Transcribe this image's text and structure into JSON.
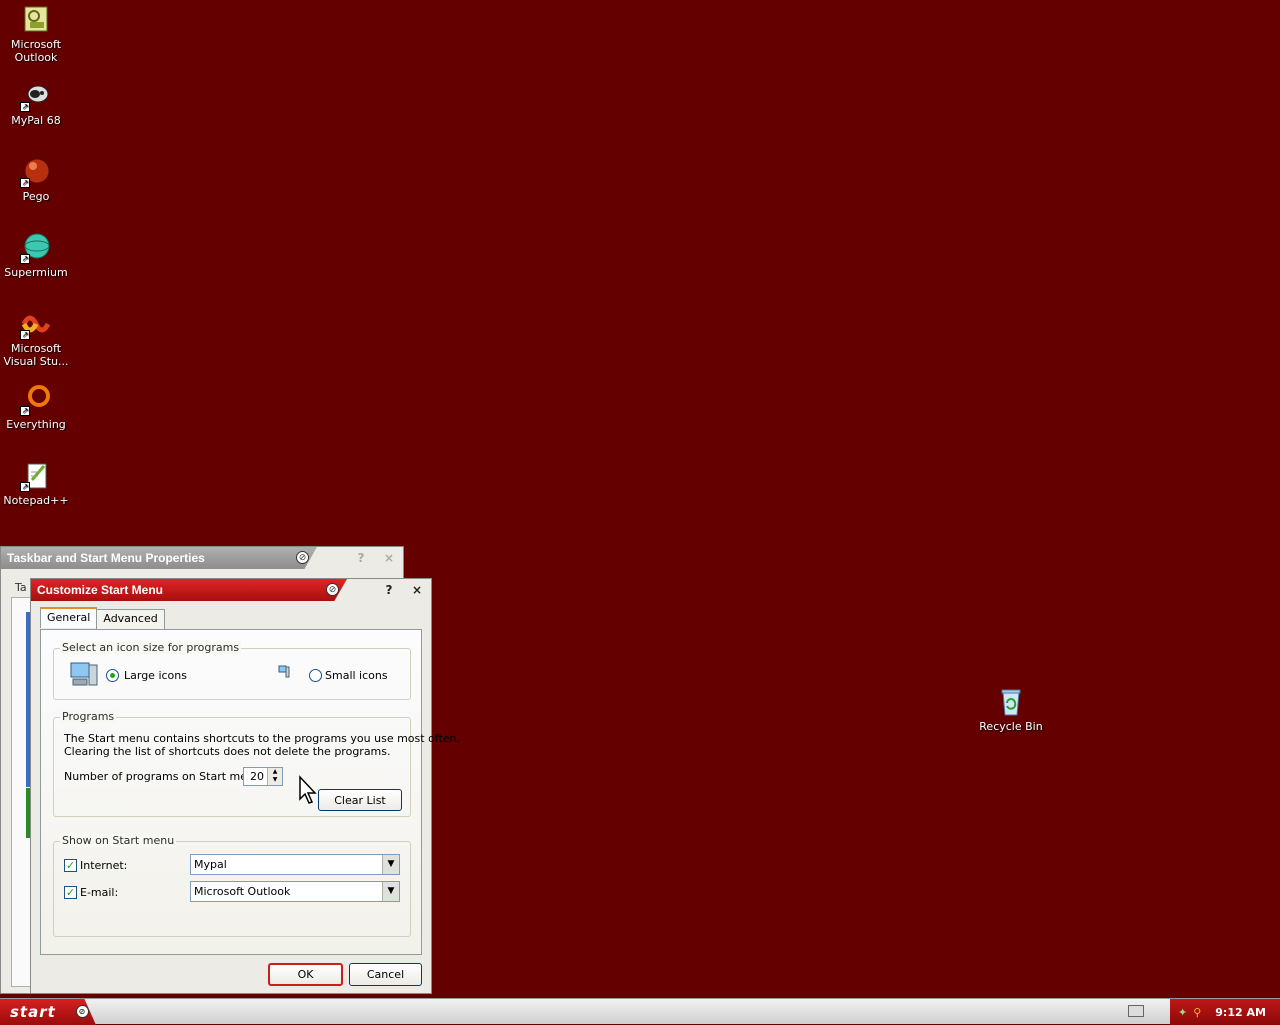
{
  "desktop": {
    "icons": [
      {
        "label": "Microsoft Outlook",
        "icon": "outlook-icon"
      },
      {
        "label": "MyPal 68",
        "icon": "mypal-icon"
      },
      {
        "label": "Pego",
        "icon": "pego-icon"
      },
      {
        "label": "Supermium",
        "icon": "supermium-icon"
      },
      {
        "label": "Microsoft Visual Stu...",
        "icon": "visual-studio-icon"
      },
      {
        "label": "Everything",
        "icon": "everything-icon"
      },
      {
        "label": "Notepad++",
        "icon": "notepadpp-icon"
      },
      {
        "label": "Recycle Bin",
        "icon": "recycle-bin-icon"
      }
    ]
  },
  "bg_window": {
    "title": "Taskbar and Start Menu Properties",
    "tab_fragment": "Ta",
    "help": "?",
    "close": "×"
  },
  "dialog": {
    "title": "Customize Start Menu",
    "help": "?",
    "close": "×",
    "tabs": [
      "General",
      "Advanced"
    ],
    "icon_group": {
      "label": "Select an icon size for programs",
      "large": "Large icons",
      "small": "Small icons",
      "selected": "large"
    },
    "programs_group": {
      "label": "Programs",
      "desc_line1": "The Start menu contains shortcuts to the programs you use most often.",
      "desc_line2": "Clearing the list of shortcuts does not delete the programs.",
      "count_label": "Number of programs on Start menu:",
      "count_value": "20",
      "clear_button": "Clear List"
    },
    "show_group": {
      "label": "Show on Start menu",
      "internet_label": "Internet:",
      "internet_value": "Mypal",
      "internet_checked": true,
      "email_label": "E-mail:",
      "email_value": "Microsoft Outlook",
      "email_checked": true
    },
    "ok": "OK",
    "cancel": "Cancel"
  },
  "taskbar": {
    "start_label": "start",
    "clock": "9:12 AM"
  },
  "colors": {
    "desktop": "#640000",
    "accent_red": "#c81e1e"
  }
}
